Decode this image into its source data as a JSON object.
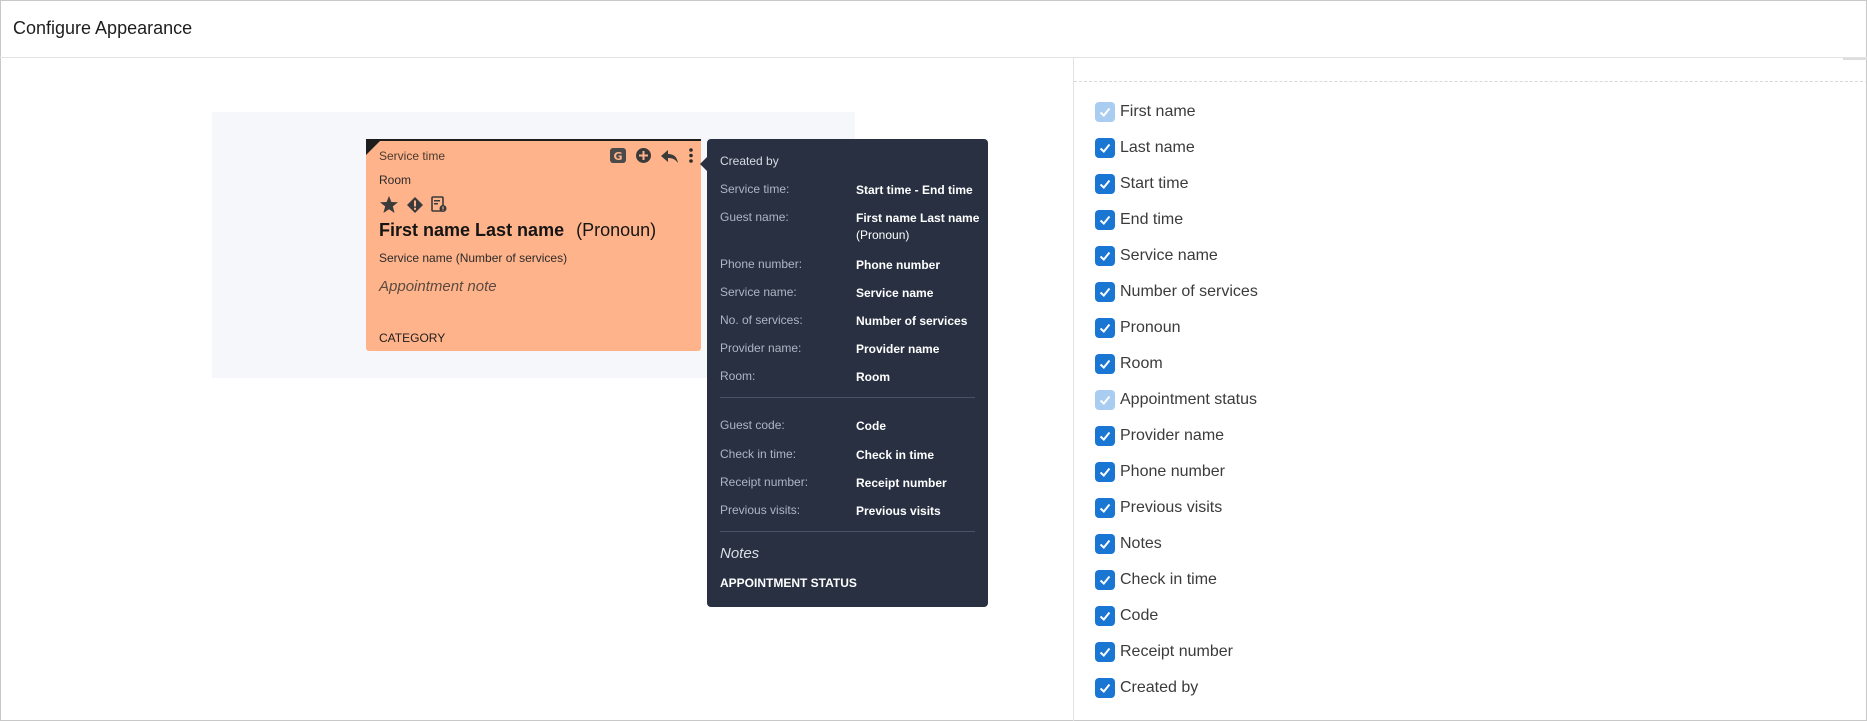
{
  "header": {
    "title": "Configure Appearance"
  },
  "card": {
    "service_time": "Service time",
    "room": "Room",
    "first_name": "First name",
    "last_name": "Last name",
    "pronoun": "(Pronoun)",
    "service_name": "Service name",
    "num_services": "(Number of services)",
    "note": "Appointment note",
    "category": "CATEGORY",
    "background_color": "#ffb38a",
    "icons": [
      "star-icon",
      "alert-icon",
      "form-icon"
    ],
    "actions": [
      "g-badge-icon",
      "add-circle-icon",
      "reply-icon",
      "more-vertical-icon"
    ]
  },
  "tooltip": {
    "created_by": "Created by",
    "rows": [
      {
        "label": "Service time:",
        "value": "Start time  -  End time"
      },
      {
        "label": "Guest name:",
        "value": "First name Last name",
        "sub": "(Pronoun)"
      },
      {
        "label": "Phone number:",
        "value": "Phone number"
      },
      {
        "label": "Service name:",
        "value": "Service name"
      },
      {
        "label": "No. of services:",
        "value": "Number of services"
      },
      {
        "label": "Provider name:",
        "value": "Provider name"
      },
      {
        "label": "Room:",
        "value": "Room"
      }
    ],
    "rows2": [
      {
        "label": "Guest code:",
        "value": "Code"
      },
      {
        "label": "Check in time:",
        "value": "Check in time"
      },
      {
        "label": "Receipt number:",
        "value": "Receipt number"
      },
      {
        "label": "Previous visits:",
        "value": "Previous visits"
      }
    ],
    "notes": "Notes",
    "appointment_status": "APPOINTMENT STATUS",
    "background_color": "#283041"
  },
  "fields": [
    {
      "label": "First name",
      "checked": true,
      "disabled": true
    },
    {
      "label": "Last name",
      "checked": true,
      "disabled": false
    },
    {
      "label": "Start time",
      "checked": true,
      "disabled": false
    },
    {
      "label": "End time",
      "checked": true,
      "disabled": false
    },
    {
      "label": "Service name",
      "checked": true,
      "disabled": false
    },
    {
      "label": "Number of services",
      "checked": true,
      "disabled": false
    },
    {
      "label": "Pronoun",
      "checked": true,
      "disabled": false
    },
    {
      "label": "Room",
      "checked": true,
      "disabled": false
    },
    {
      "label": "Appointment status",
      "checked": true,
      "disabled": true
    },
    {
      "label": "Provider name",
      "checked": true,
      "disabled": false
    },
    {
      "label": "Phone number",
      "checked": true,
      "disabled": false
    },
    {
      "label": "Previous visits",
      "checked": true,
      "disabled": false
    },
    {
      "label": "Notes",
      "checked": true,
      "disabled": false
    },
    {
      "label": "Check in time",
      "checked": true,
      "disabled": false
    },
    {
      "label": "Code",
      "checked": true,
      "disabled": false
    },
    {
      "label": "Receipt number",
      "checked": true,
      "disabled": false
    },
    {
      "label": "Created by",
      "checked": true,
      "disabled": false
    }
  ],
  "colors": {
    "checkbox": "#1976d2",
    "checkbox_disabled": "#a9cdf0"
  }
}
